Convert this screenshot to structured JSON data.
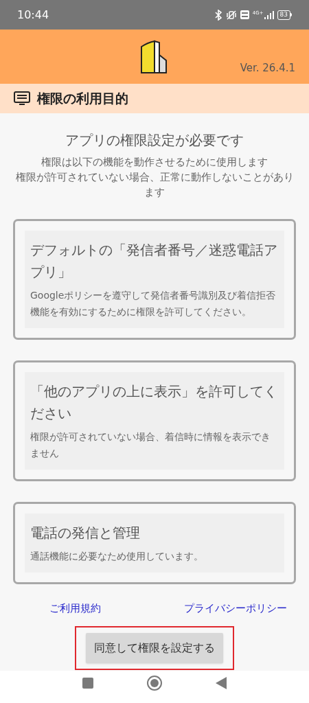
{
  "status_bar": {
    "time": "10:44",
    "network": "4G+",
    "battery": "83"
  },
  "header": {
    "version": "Ver. 26.4.1"
  },
  "section": {
    "title": "権限の利用目的"
  },
  "intro": {
    "heading": "アプリの権限設定が必要です",
    "lines": [
      "権限は以下の機能を動作させるために使用します",
      "権限が許可されていない場合、正常に動作しないことがあります"
    ]
  },
  "permissions": [
    {
      "title": "デフォルトの「発信者番号／迷惑電話アプリ」",
      "description": "Googleポリシーを遵守して発信者番号識別及び着信拒否機能を有効にするために権限を許可してください。"
    },
    {
      "title": "「他のアプリの上に表示」を許可してください",
      "description": "権限が許可されていない場合、着信時に情報を表示できません"
    },
    {
      "title": "電話の発信と管理",
      "description": "通話機能に必要なため使用しています。"
    }
  ],
  "links": [
    "ご利用規約",
    "プライバシーポリシー"
  ],
  "agree_button": {
    "label": "同意して権限を設定する",
    "highlighted": true
  }
}
